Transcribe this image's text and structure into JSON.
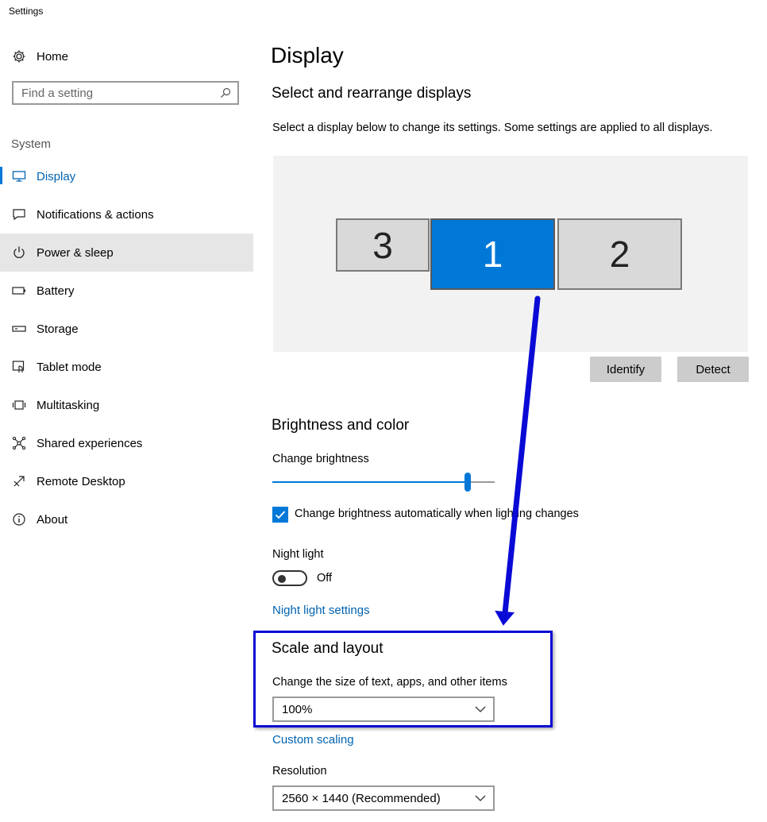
{
  "window": {
    "title": "Settings"
  },
  "sidebar": {
    "home_label": "Home",
    "search_placeholder": "Find a setting",
    "section": "System",
    "items": [
      {
        "label": "Display",
        "icon": "monitor-icon"
      },
      {
        "label": "Notifications & actions",
        "icon": "notification-icon"
      },
      {
        "label": "Power & sleep",
        "icon": "power-icon"
      },
      {
        "label": "Battery",
        "icon": "battery-icon"
      },
      {
        "label": "Storage",
        "icon": "storage-icon"
      },
      {
        "label": "Tablet mode",
        "icon": "tablet-icon"
      },
      {
        "label": "Multitasking",
        "icon": "multitasking-icon"
      },
      {
        "label": "Shared experiences",
        "icon": "share-icon"
      },
      {
        "label": "Remote Desktop",
        "icon": "remote-desktop-icon"
      },
      {
        "label": "About",
        "icon": "info-icon"
      }
    ]
  },
  "main": {
    "title": "Display",
    "arrange": {
      "heading": "Select and rearrange displays",
      "description": "Select a display below to change its settings. Some settings are applied to all displays.",
      "monitors": [
        "3",
        "1",
        "2"
      ],
      "identify_label": "Identify",
      "detect_label": "Detect"
    },
    "brightness": {
      "heading": "Brightness and color",
      "change_label": "Change brightness",
      "level_percent": 89,
      "auto_label": "Change brightness automatically when lighting changes",
      "auto_checked": true,
      "night_light_label": "Night light",
      "night_light_state": "Off",
      "night_light_link": "Night light settings"
    },
    "scale": {
      "heading": "Scale and layout",
      "size_label": "Change the size of text, apps, and other items",
      "size_value": "100%",
      "custom_link": "Custom scaling",
      "resolution_label": "Resolution",
      "resolution_value": "2560 × 1440 (Recommended)"
    }
  },
  "colors": {
    "accent": "#0078d7",
    "annotation": "#0a0ad6"
  }
}
